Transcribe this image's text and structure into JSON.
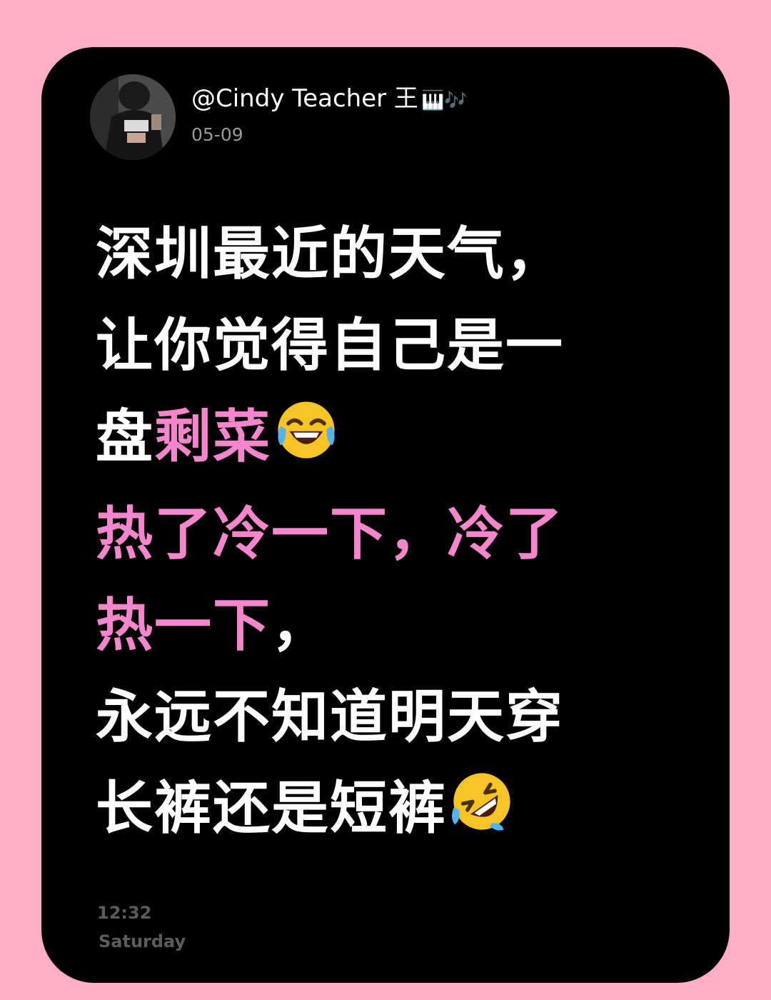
{
  "post": {
    "username": "@Cindy Teacher 王",
    "username_emoji": "🎹🎶",
    "date": "05-09",
    "lines": [
      {
        "segments": [
          {
            "text": "深圳最近的天气，",
            "color": "white"
          }
        ]
      },
      {
        "segments": [
          {
            "text": "让你觉得自己是一",
            "color": "white"
          }
        ]
      },
      {
        "segments": [
          {
            "text": "盘",
            "color": "white"
          },
          {
            "text": "剩菜",
            "color": "pink"
          }
        ],
        "emoji": "face-with-tears-of-joy-icon"
      },
      {
        "segments": [
          {
            "text": "热了冷一下，冷了",
            "color": "pink"
          }
        ]
      },
      {
        "segments": [
          {
            "text": "热一下",
            "color": "pink"
          },
          {
            "text": "，",
            "color": "white"
          }
        ]
      },
      {
        "segments": [
          {
            "text": "永远不知道明天穿",
            "color": "white"
          }
        ]
      },
      {
        "segments": [
          {
            "text": "长裤还是短裤",
            "color": "white"
          }
        ],
        "emoji": "rolling-on-floor-laughing-icon"
      }
    ]
  },
  "clock": {
    "time": "12:32",
    "day": "Saturday"
  },
  "colors": {
    "background": "#ffafc4",
    "card": "#000000",
    "text": "#ffffff",
    "highlight": "#f585cc",
    "muted": "#5c5c5c"
  }
}
